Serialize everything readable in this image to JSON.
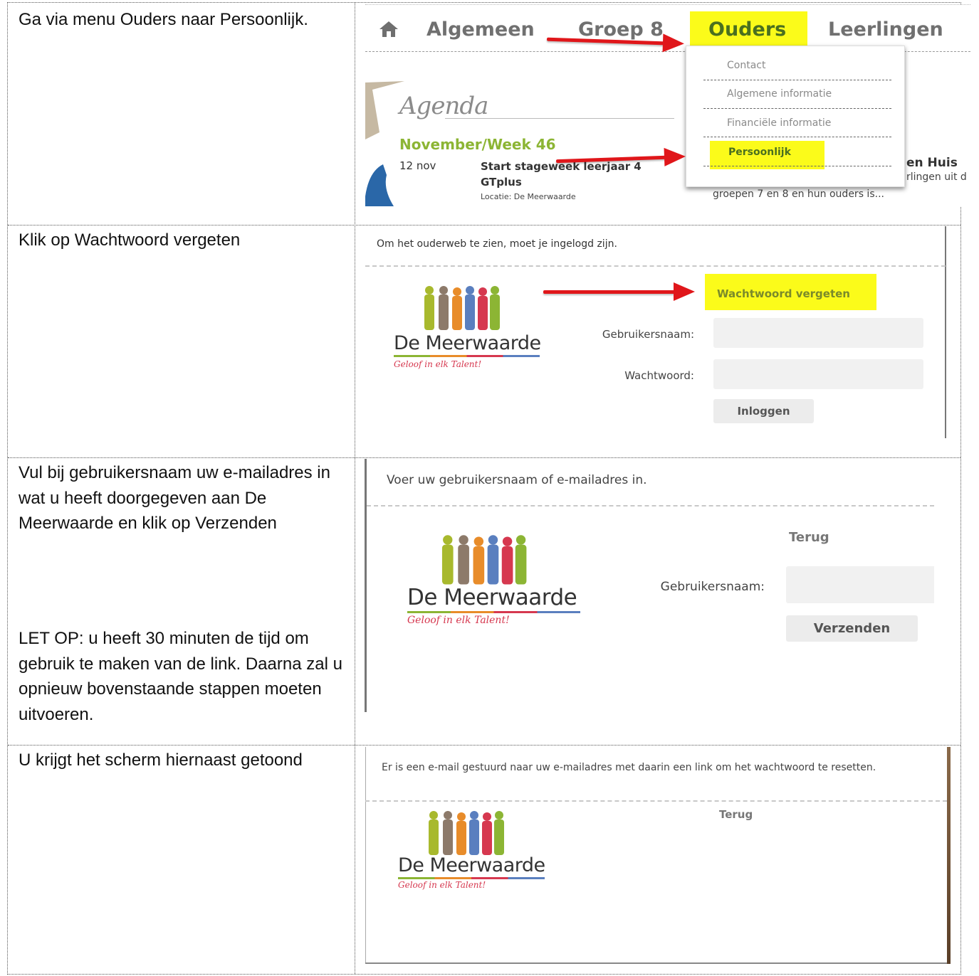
{
  "rows": [
    {
      "instruction": "Ga via menu Ouders naar Persoonlijk."
    },
    {
      "instruction": "Klik op Wachtwoord vergeten"
    },
    {
      "instruction": "Vul bij gebruikersnaam uw e-mailadres in wat u heeft doorgegeven aan De Meerwaarde en klik op Verzenden",
      "note": "LET OP: u heeft 30 minuten de tijd om gebruik te maken van de link. Daarna zal u opnieuw bovenstaande stappen moeten uitvoeren."
    },
    {
      "instruction": "U krijgt het scherm hiernaast getoond"
    }
  ],
  "shot1": {
    "nav": {
      "home_icon": "home-icon",
      "algemeen": "Algemeen",
      "groep8": "Groep 8",
      "ouders": "Ouders",
      "leerlingen": "Leerlingen"
    },
    "dropdown": [
      "Contact",
      "Algemene informatie",
      "Financiële informatie",
      "Persoonlijk"
    ],
    "agenda_title": "Agenda",
    "week": "November/Week 46",
    "date": "12 nov",
    "event_title": "Start stageweek leerjaar 4 GTplus",
    "location": "Locatie: De Meerwaarde",
    "side_title": "en Huis",
    "side_text": "rlingen uit d",
    "side_text2": "groepen 7 en 8 en hun ouders is..."
  },
  "shot2": {
    "intro": "Om het ouderweb te zien, moet je ingelogd zijn.",
    "forgot": "Wachtwoord vergeten",
    "username_label": "Gebruikersnaam:",
    "password_label": "Wachtwoord:",
    "login_button": "Inloggen"
  },
  "shot3": {
    "intro": "Voer uw gebruikersnaam of e-mailadres in.",
    "back": "Terug",
    "username_label": "Gebruikersnaam:",
    "send_button": "Verzenden"
  },
  "shot4": {
    "message": "Er is een e-mail gestuurd naar uw e-mailadres met daarin een link om het wachtwoord te resetten.",
    "back": "Terug"
  },
  "logo": {
    "name": "De Meerwaarde",
    "tagline": "Geloof in elk Talent!"
  },
  "colors": {
    "highlight": "#fbfb1a",
    "arrow": "#e0161a",
    "green": "#8cb534",
    "tag": "#d6384f"
  }
}
